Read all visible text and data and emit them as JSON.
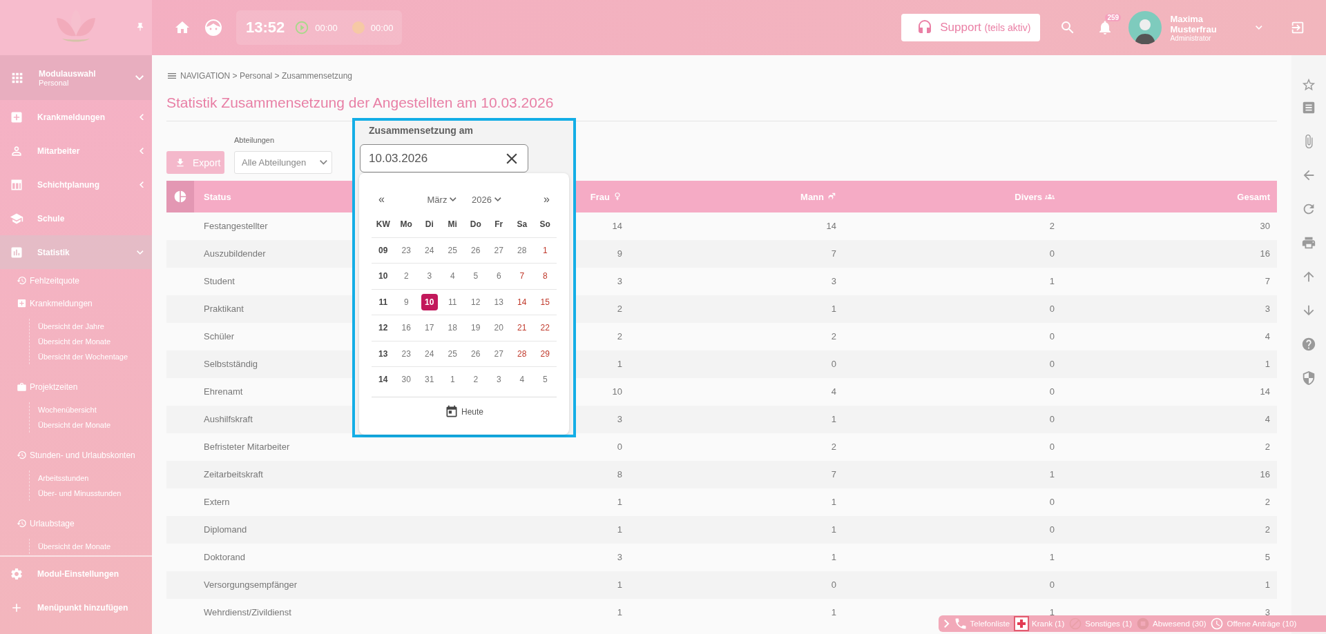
{
  "topbar": {
    "time": "13:52",
    "timers": [
      {
        "kind": "play",
        "value": "00:00"
      },
      {
        "kind": "pause",
        "value": "00:00"
      }
    ],
    "support": {
      "label": "Support",
      "note": "(teils aktiv)"
    },
    "notifications": "259",
    "user": {
      "name": "Maxima Musterfrau",
      "role": "Administrator"
    }
  },
  "sidebar": {
    "module": {
      "title": "Modulauswahl",
      "subtitle": "Personal"
    },
    "items": [
      {
        "label": "Krankmeldungen",
        "kind": "group",
        "expanded": false,
        "selected": false
      },
      {
        "label": "Mitarbeiter",
        "kind": "group",
        "expanded": false,
        "selected": false
      },
      {
        "label": "Schichtplanung",
        "kind": "group",
        "expanded": false,
        "selected": false
      },
      {
        "label": "Schule",
        "kind": "link",
        "selected": false
      },
      {
        "label": "Statistik",
        "kind": "group",
        "expanded": true,
        "selected": true,
        "children": [
          {
            "label": "Fehlzeitquote"
          },
          {
            "label": "Krankmeldungen",
            "children": [
              {
                "label": "Übersicht der Jahre"
              },
              {
                "label": "Übersicht der Monate"
              },
              {
                "label": "Übersicht der Wochentage"
              }
            ]
          },
          {
            "label": "Projektzeiten",
            "children": [
              {
                "label": "Wochenübersicht"
              },
              {
                "label": "Übersicht der Monate"
              }
            ]
          },
          {
            "label": "Stunden- und Urlaubskonten",
            "children": [
              {
                "label": "Arbeitsstunden"
              },
              {
                "label": "Über- und Minusstunden"
              }
            ]
          },
          {
            "label": "Urlaubstage",
            "children": [
              {
                "label": "Übersicht der Monate"
              }
            ]
          }
        ]
      }
    ],
    "footer": [
      "Modul-Einstellungen",
      "Menüpunkt hinzufügen"
    ]
  },
  "breadcrumb": "NAVIGATION > Personal > Zusammensetzung",
  "title": "Statistik Zusammensetzung der Angestellten am 10.03.2026",
  "filters": {
    "export": "Export",
    "department_label": "Abteilungen",
    "department_value": "Alle Abteilungen",
    "date_label": "Zusammensetzung am",
    "date_value": "10.03.2026"
  },
  "calendar": {
    "prev": "«",
    "next": "»",
    "month": "März",
    "year": "2026",
    "header": [
      "KW",
      "Mo",
      "Di",
      "Mi",
      "Do",
      "Fr",
      "Sa",
      "So"
    ],
    "today": "Heute",
    "weeks": [
      {
        "kw": "09",
        "days": [
          {
            "label": "23",
            "weekend": false,
            "selected": false
          },
          {
            "label": "24",
            "weekend": false,
            "selected": false
          },
          {
            "label": "25",
            "weekend": false,
            "selected": false
          },
          {
            "label": "26",
            "weekend": false,
            "selected": false
          },
          {
            "label": "27",
            "weekend": false,
            "selected": false
          },
          {
            "label": "28",
            "weekend": false,
            "selected": false
          },
          {
            "label": "1",
            "weekend": true,
            "selected": false
          }
        ]
      },
      {
        "kw": "10",
        "days": [
          {
            "label": "2",
            "weekend": false,
            "selected": false
          },
          {
            "label": "3",
            "weekend": false,
            "selected": false
          },
          {
            "label": "4",
            "weekend": false,
            "selected": false
          },
          {
            "label": "5",
            "weekend": false,
            "selected": false
          },
          {
            "label": "6",
            "weekend": false,
            "selected": false
          },
          {
            "label": "7",
            "weekend": true,
            "selected": false
          },
          {
            "label": "8",
            "weekend": true,
            "selected": false
          }
        ]
      },
      {
        "kw": "11",
        "days": [
          {
            "label": "9",
            "weekend": false,
            "selected": false
          },
          {
            "label": "10",
            "weekend": false,
            "selected": true
          },
          {
            "label": "11",
            "weekend": false,
            "selected": false
          },
          {
            "label": "12",
            "weekend": false,
            "selected": false
          },
          {
            "label": "13",
            "weekend": false,
            "selected": false
          },
          {
            "label": "14",
            "weekend": true,
            "selected": false
          },
          {
            "label": "15",
            "weekend": true,
            "selected": false
          }
        ]
      },
      {
        "kw": "12",
        "days": [
          {
            "label": "16",
            "weekend": false,
            "selected": false
          },
          {
            "label": "17",
            "weekend": false,
            "selected": false
          },
          {
            "label": "18",
            "weekend": false,
            "selected": false
          },
          {
            "label": "19",
            "weekend": false,
            "selected": false
          },
          {
            "label": "20",
            "weekend": false,
            "selected": false
          },
          {
            "label": "21",
            "weekend": true,
            "selected": false
          },
          {
            "label": "22",
            "weekend": true,
            "selected": false
          }
        ]
      },
      {
        "kw": "13",
        "days": [
          {
            "label": "23",
            "weekend": false,
            "selected": false
          },
          {
            "label": "24",
            "weekend": false,
            "selected": false
          },
          {
            "label": "25",
            "weekend": false,
            "selected": false
          },
          {
            "label": "26",
            "weekend": false,
            "selected": false
          },
          {
            "label": "27",
            "weekend": false,
            "selected": false
          },
          {
            "label": "28",
            "weekend": true,
            "selected": false
          },
          {
            "label": "29",
            "weekend": true,
            "selected": false
          }
        ]
      },
      {
        "kw": "14",
        "days": [
          {
            "label": "30",
            "weekend": false,
            "selected": false
          },
          {
            "label": "31",
            "weekend": false,
            "selected": false
          },
          {
            "label": "1",
            "weekend": false,
            "selected": false
          },
          {
            "label": "2",
            "weekend": false,
            "selected": false
          },
          {
            "label": "3",
            "weekend": false,
            "selected": false
          },
          {
            "label": "4",
            "weekend": false,
            "selected": false
          },
          {
            "label": "5",
            "weekend": false,
            "selected": false
          }
        ]
      }
    ]
  },
  "table": {
    "columns": [
      {
        "label": "Status",
        "kind": "text"
      },
      {
        "label": "Frau",
        "kind": "female"
      },
      {
        "label": "Mann",
        "kind": "male"
      },
      {
        "label": "Divers",
        "kind": "divers"
      },
      {
        "label": "Gesamt",
        "kind": "total"
      }
    ],
    "rows": [
      {
        "status": "Festangestellter",
        "values": [
          "14",
          "14",
          "2",
          "30"
        ]
      },
      {
        "status": "Auszubildender",
        "values": [
          "9",
          "7",
          "0",
          "16"
        ]
      },
      {
        "status": "Student",
        "values": [
          "3",
          "3",
          "1",
          "7"
        ]
      },
      {
        "status": "Praktikant",
        "values": [
          "2",
          "1",
          "0",
          "3"
        ]
      },
      {
        "status": "Schüler",
        "values": [
          "2",
          "2",
          "0",
          "4"
        ]
      },
      {
        "status": "Selbstständig",
        "values": [
          "1",
          "0",
          "0",
          "1"
        ]
      },
      {
        "status": "Ehrenamt",
        "values": [
          "10",
          "4",
          "0",
          "14"
        ]
      },
      {
        "status": "Aushilfskraft",
        "values": [
          "3",
          "1",
          "0",
          "4"
        ]
      },
      {
        "status": "Befristeter Mitarbeiter",
        "values": [
          "0",
          "2",
          "0",
          "2"
        ]
      },
      {
        "status": "Zeitarbeitskraft",
        "values": [
          "8",
          "7",
          "1",
          "16"
        ]
      },
      {
        "status": "Extern",
        "values": [
          "1",
          "1",
          "0",
          "2"
        ]
      },
      {
        "status": "Diplomand",
        "values": [
          "1",
          "1",
          "0",
          "2"
        ]
      },
      {
        "status": "Doktorand",
        "values": [
          "3",
          "1",
          "1",
          "5"
        ]
      },
      {
        "status": "Versorgungsempfänger",
        "values": [
          "1",
          "0",
          "0",
          "1"
        ]
      },
      {
        "status": "Wehrdienst/Zivildienst",
        "values": [
          "1",
          "1",
          "1",
          "3"
        ]
      }
    ]
  },
  "status_bar": [
    {
      "kind": "phone",
      "label": "Telefonliste"
    },
    {
      "kind": "sick",
      "label": "Krank (1)"
    },
    {
      "kind": "other",
      "label": "Sonstiges (1)"
    },
    {
      "kind": "absent",
      "label": "Abwesend (30)"
    },
    {
      "kind": "requests",
      "label": "Offene Anträge (10)"
    }
  ]
}
